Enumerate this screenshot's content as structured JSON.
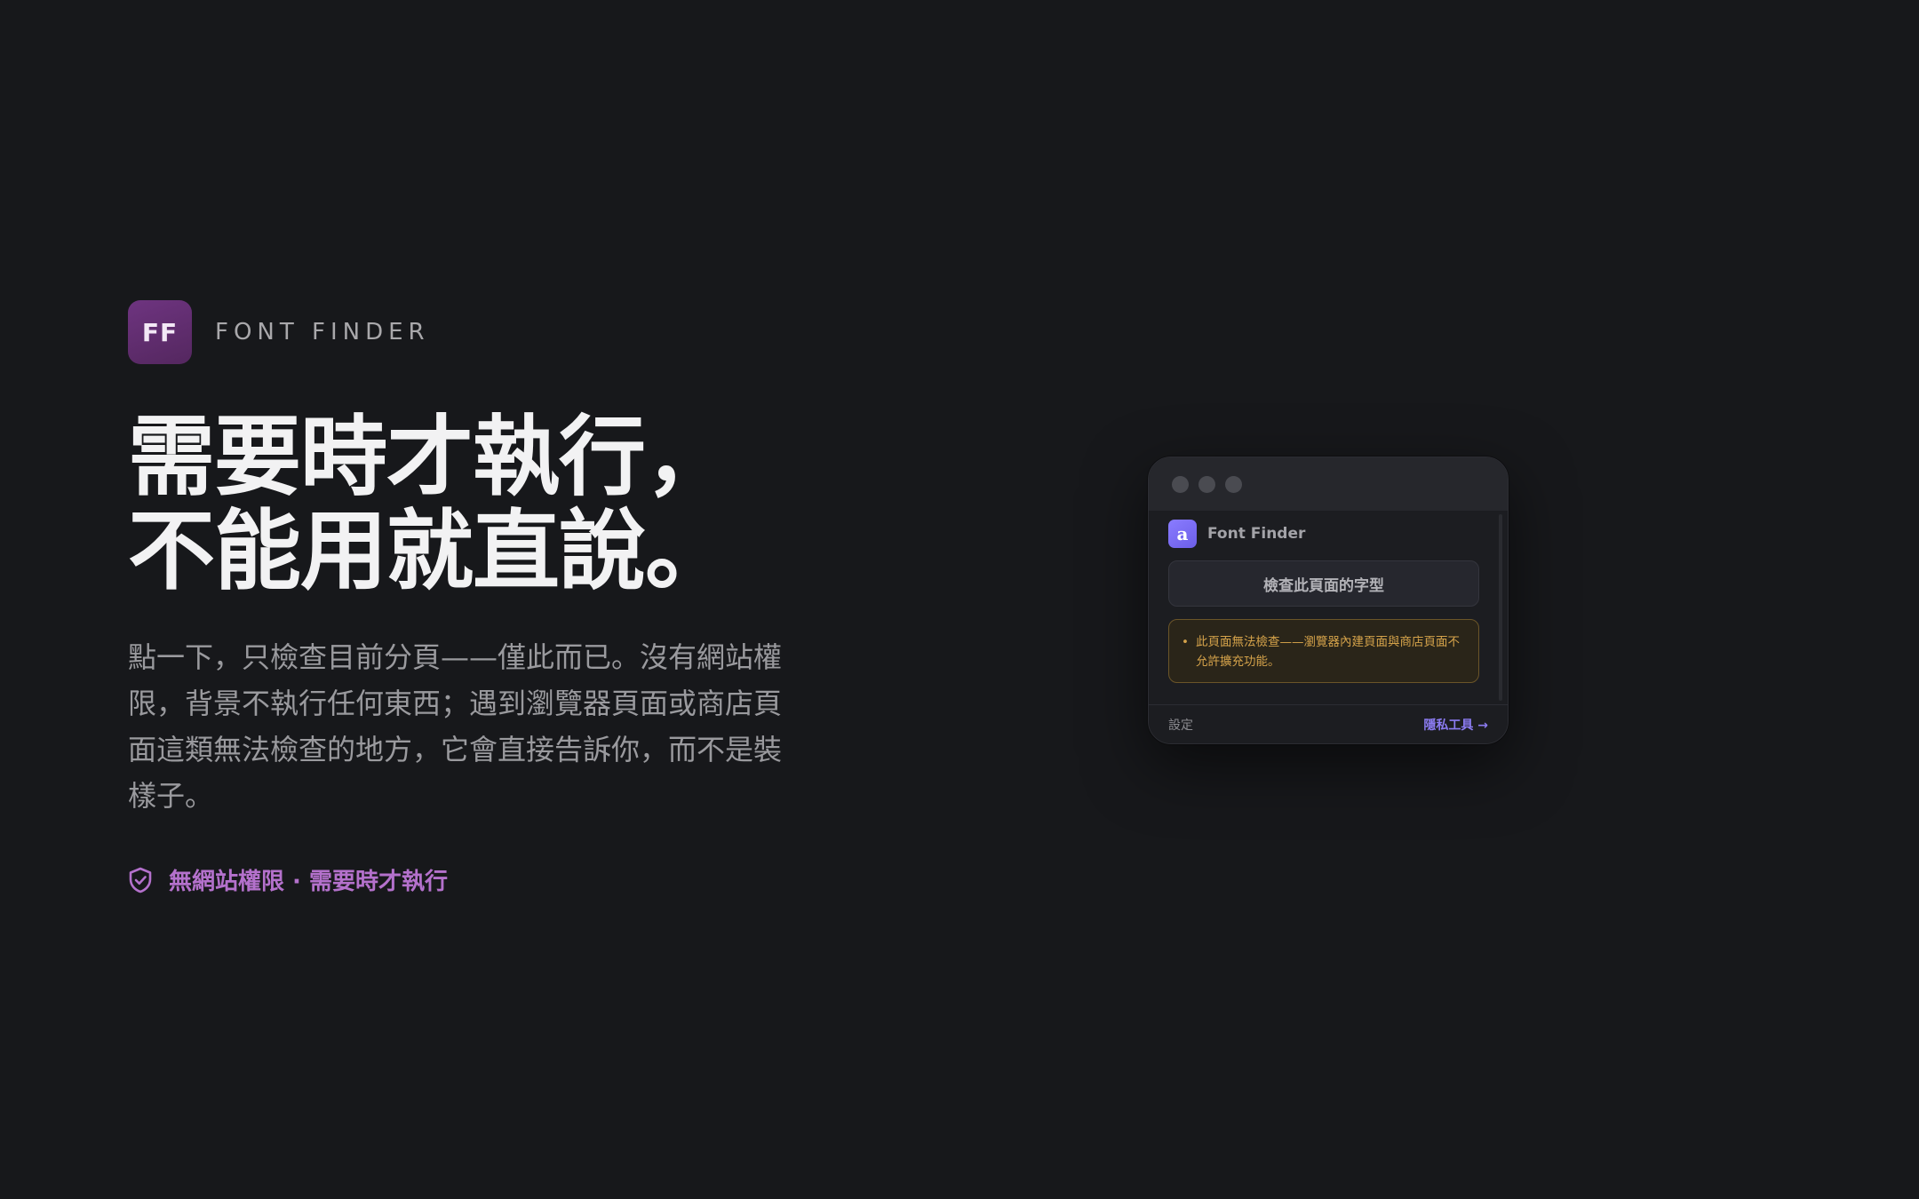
{
  "brand": {
    "logo_text": "FF",
    "name": "FONT FINDER"
  },
  "hero": {
    "headline_line1": "需要時才執行，",
    "headline_line2": "不能用就直說。",
    "description": "點一下，只檢查目前分頁——僅此而已。沒有網站權限，背景不執行任何東西；遇到瀏覽器頁面或商店頁面這類無法檢查的地方，它會直接告訴你，而不是裝樣子。",
    "badge_text": "無網站權限 · 需要時才執行",
    "badge_icon": "shield-check-icon"
  },
  "popup": {
    "app_icon_text": "a",
    "app_name": "Font Finder",
    "inspect_button_label": "檢查此頁面的字型",
    "warning_bullet": "•",
    "warning_text": "此頁面無法檢查——瀏覽器內建頁面與商店頁面不允許擴充功能。",
    "footer_settings": "設定",
    "footer_privacy": "隱私工具 →"
  },
  "colors": {
    "background": "#17181b",
    "brand_logo": "#64307a",
    "accent_purple": "#b471cc",
    "warning": "#d4a24a",
    "link": "#8c7cf2"
  }
}
